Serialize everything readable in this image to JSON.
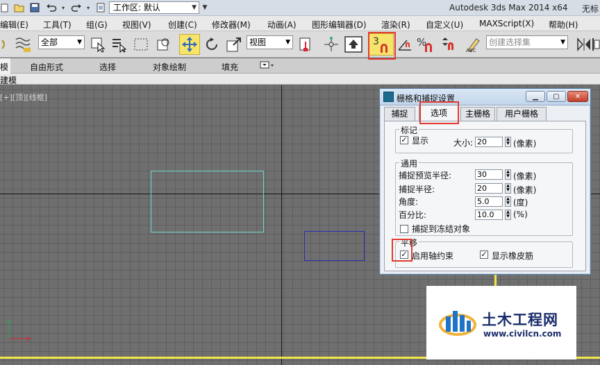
{
  "titlebar": {
    "workspace": "工作区: 默认",
    "app_title": "Autodesk 3ds Max  2014 x64",
    "file_name": "无标"
  },
  "menu": [
    "编辑(E)",
    "工具(T)",
    "组(G)",
    "视图(V)",
    "创建(C)",
    "修改器(M)",
    "动画(A)",
    "图形编辑器(D)",
    "渲染(R)",
    "自定义(U)",
    "MAXScript(X)",
    "帮助(H)"
  ],
  "toolbar": {
    "selection_filter": "全部",
    "reference_coord": "视图",
    "named_selection_placeholder": "创建选择集",
    "snap_toggle_label": "3",
    "percent_snap_label": "%"
  },
  "ribbon": {
    "tabs": [
      "模",
      "自由形式",
      "选择",
      "对象绘制",
      "填充"
    ],
    "sub_label": "建模"
  },
  "viewport": {
    "label": "[+][顶][线框]"
  },
  "dialog": {
    "title": "栅格和捕捉设置",
    "tabs": [
      "捕捉",
      "选项",
      "主栅格",
      "用户栅格"
    ],
    "marker_group": {
      "legend": "标记",
      "display_label": "显示",
      "display_checked": true,
      "size_label": "大小:",
      "size_value": "20",
      "size_unit": "(像素)"
    },
    "general_group": {
      "legend": "通用",
      "rows": [
        {
          "label": "捕捉预览半径:",
          "value": "30",
          "unit": "(像素)"
        },
        {
          "label": "捕捉半径:",
          "value": "20",
          "unit": "(像素)"
        },
        {
          "label": "角度:",
          "value": "5.0",
          "unit": "(度)"
        },
        {
          "label": "百分比:",
          "value": "10.0",
          "unit": "(%)"
        }
      ],
      "snap_frozen_label": "捕捉到冻结对象",
      "snap_frozen_checked": false
    },
    "translation_group": {
      "legend": "平移",
      "axis_constraint_label": "启用轴约束",
      "axis_constraint_checked": true,
      "rubber_band_label": "显示橡皮筋",
      "rubber_band_checked": true
    }
  },
  "watermark": {
    "name": "土木工程网",
    "url": "www.civilcn.com"
  },
  "colors": {
    "highlight_red": "#e2392e",
    "snap_yellow": "#f7e46a",
    "viewport_cyan": "#6ed8d0",
    "viewport_blue": "#2a2ab5"
  }
}
